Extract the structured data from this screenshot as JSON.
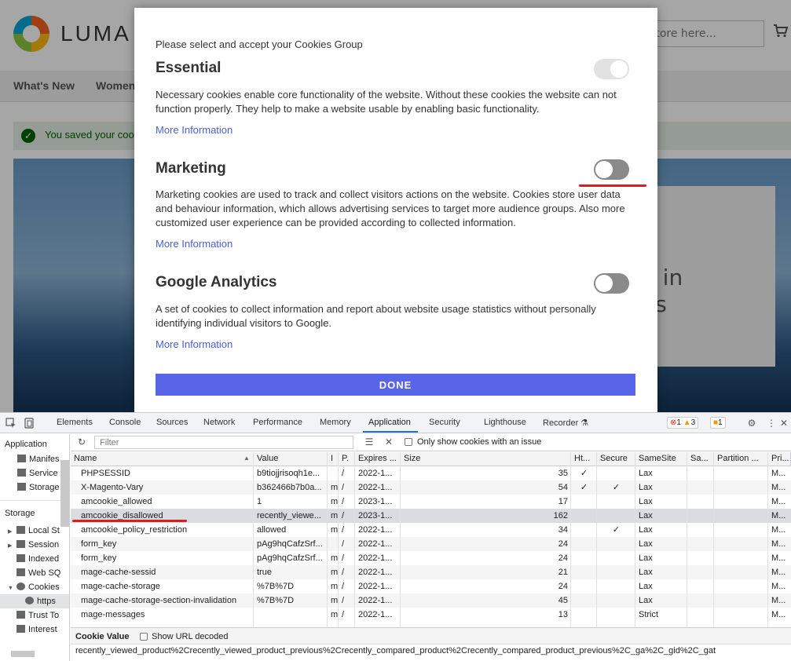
{
  "site": {
    "logo_text": "LUMA",
    "search_placeholder": "e store here...",
    "nav": [
      "What's New",
      "Women"
    ],
    "message": "You saved your cooki",
    "hero_text": "b in\nes"
  },
  "modal": {
    "intro": "Please select and accept your Cookies Group",
    "groups": [
      {
        "title": "Essential",
        "description": "Necessary cookies enable core functionality of the website. Without these cookies the website can not function properly. They help to make a website usable by enabling basic functionality.",
        "more": "More Information",
        "enabled": true,
        "locked": true
      },
      {
        "title": "Marketing",
        "description": "Marketing cookies are used to track and collect visitors actions on the website. Cookies store user data and behaviour information, which allows advertising services to target more audience groups. Also more customized user experience can be provided according to collected information.",
        "more": "More Information",
        "enabled": false,
        "locked": false
      },
      {
        "title": "Google Analytics",
        "description": "A set of cookies to collect information and report about website usage statistics without personally identifying individual visitors to Google.",
        "more": "More Information",
        "enabled": false,
        "locked": false
      }
    ],
    "done_label": "DONE",
    "accent_color": "#5865e8",
    "link_color": "#4a5fd0"
  },
  "devtools": {
    "tabs": [
      "Elements",
      "Console",
      "Sources",
      "Network",
      "Performance",
      "Memory",
      "Application",
      "Security",
      "Lighthouse",
      "Recorder ⚗"
    ],
    "active_tab": "Application",
    "errors": "1",
    "warnings": "3",
    "issues": "1",
    "sidebar": {
      "application_header": "Application",
      "application_items": [
        "Manifes",
        "Service",
        "Storage"
      ],
      "storage_header": "Storage",
      "storage_items": [
        "Local St",
        "Session",
        "Indexed",
        "Web SQ",
        "Cookies",
        "https",
        "Trust To",
        "Interest"
      ]
    },
    "filter_placeholder": "Filter",
    "only_issue_label": "Only show cookies with an issue",
    "columns": [
      "Name",
      "Value",
      "I",
      "P.",
      "Expires ...",
      "Size",
      "Ht...",
      "Secure",
      "SameSite",
      "Sa...",
      "Partition ...",
      "Pri..."
    ],
    "rows": [
      {
        "name": "PHPSESSID",
        "value": "b9tiojjrisoqh1e...",
        "d": "",
        "p": "/",
        "exp": "2022-1...",
        "size": "35",
        "http": "✓",
        "secure": "",
        "same": "Lax",
        "pri": "M..."
      },
      {
        "name": "X-Magento-Vary",
        "value": "b362466b7b0a...",
        "d": "m",
        "p": "/",
        "exp": "2022-1...",
        "size": "54",
        "http": "✓",
        "secure": "✓",
        "same": "Lax",
        "pri": "M..."
      },
      {
        "name": "amcookie_allowed",
        "value": "1",
        "d": "m",
        "p": "/",
        "exp": "2023-1...",
        "size": "17",
        "http": "",
        "secure": "",
        "same": "Lax",
        "pri": "M..."
      },
      {
        "name": "amcookie_disallowed",
        "value": "recently_viewe...",
        "d": "m",
        "p": "/",
        "exp": "2023-1...",
        "size": "162",
        "http": "",
        "secure": "",
        "same": "Lax",
        "pri": "M..."
      },
      {
        "name": "amcookie_policy_restriction",
        "value": "allowed",
        "d": "m",
        "p": "/",
        "exp": "2022-1...",
        "size": "34",
        "http": "",
        "secure": "✓",
        "same": "Lax",
        "pri": "M..."
      },
      {
        "name": "form_key",
        "value": "pAg9hqCafzSrf...",
        "d": "",
        "p": "/",
        "exp": "2022-1...",
        "size": "24",
        "http": "",
        "secure": "",
        "same": "Lax",
        "pri": "M..."
      },
      {
        "name": "form_key",
        "value": "pAg9hqCafzSrf...",
        "d": "m",
        "p": "/",
        "exp": "2022-1...",
        "size": "24",
        "http": "",
        "secure": "",
        "same": "Lax",
        "pri": "M..."
      },
      {
        "name": "mage-cache-sessid",
        "value": "true",
        "d": "m",
        "p": "/",
        "exp": "2022-1...",
        "size": "21",
        "http": "",
        "secure": "",
        "same": "Lax",
        "pri": "M..."
      },
      {
        "name": "mage-cache-storage",
        "value": "%7B%7D",
        "d": "m",
        "p": "/",
        "exp": "2022-1...",
        "size": "24",
        "http": "",
        "secure": "",
        "same": "Lax",
        "pri": "M..."
      },
      {
        "name": "mage-cache-storage-section-invalidation",
        "value": "%7B%7D",
        "d": "m",
        "p": "/",
        "exp": "2022-1...",
        "size": "45",
        "http": "",
        "secure": "",
        "same": "Lax",
        "pri": "M..."
      },
      {
        "name": "mage-messages",
        "value": "",
        "d": "m",
        "p": "/",
        "exp": "2022-1...",
        "size": "13",
        "http": "",
        "secure": "",
        "same": "Strict",
        "pri": "M..."
      }
    ],
    "selected_row": 3,
    "cookie_value_label": "Cookie Value",
    "show_url_decoded_label": "Show URL decoded",
    "cookie_value": "recently_viewed_product%2Crecently_viewed_product_previous%2Crecently_compared_product%2Crecently_compared_product_previous%2C_ga%2C_gid%2C_gat"
  }
}
